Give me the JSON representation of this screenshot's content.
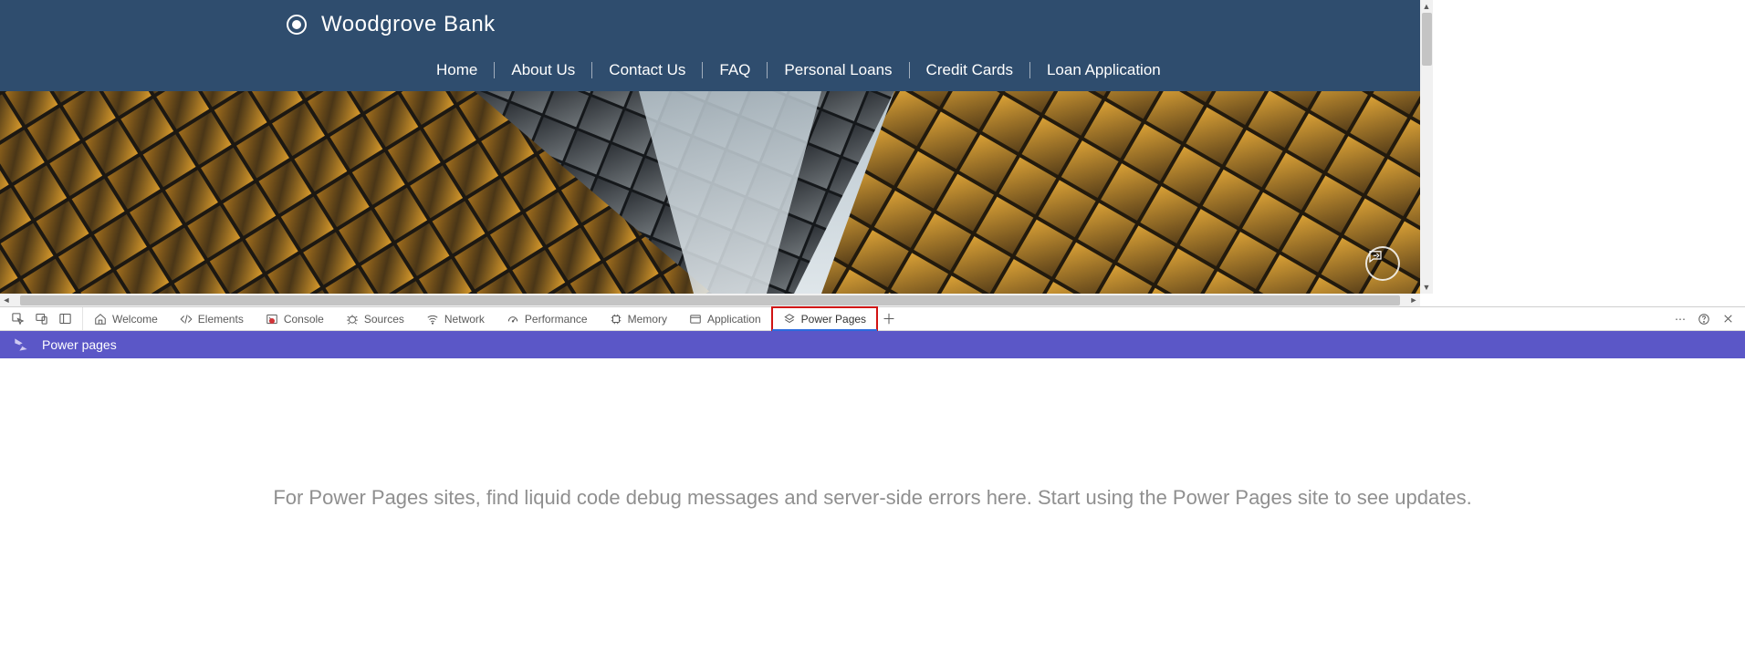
{
  "site": {
    "brand": "Woodgrove Bank",
    "nav": [
      "Home",
      "About Us",
      "Contact Us",
      "FAQ",
      "Personal Loans",
      "Credit Cards",
      "Loan Application"
    ]
  },
  "devtools": {
    "tabs": [
      {
        "id": "welcome",
        "label": "Welcome"
      },
      {
        "id": "elements",
        "label": "Elements"
      },
      {
        "id": "console",
        "label": "Console"
      },
      {
        "id": "sources",
        "label": "Sources"
      },
      {
        "id": "network",
        "label": "Network"
      },
      {
        "id": "performance",
        "label": "Performance"
      },
      {
        "id": "memory",
        "label": "Memory"
      },
      {
        "id": "application",
        "label": "Application"
      },
      {
        "id": "powerpages",
        "label": "Power Pages"
      }
    ],
    "active_tab": "powerpages",
    "highlight_tab": "powerpages"
  },
  "panel": {
    "title": "Power pages",
    "message": "For Power Pages sites, find liquid code debug messages and server-side errors here. Start using the Power Pages site to see updates."
  }
}
